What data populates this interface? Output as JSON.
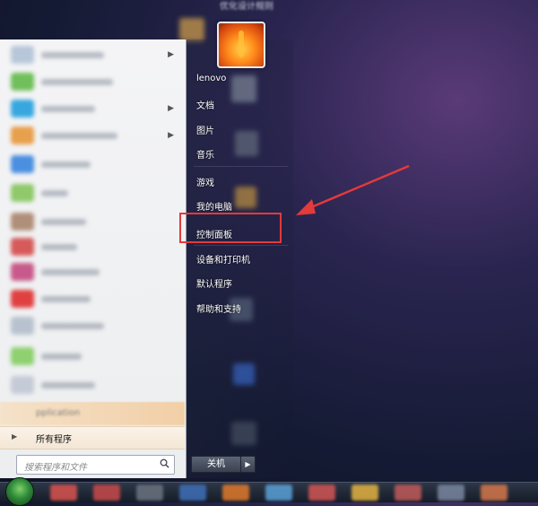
{
  "desktop": {
    "top_title": "优化设计规则"
  },
  "start_menu": {
    "left": {
      "pinned_app_label": "pplication",
      "all_programs": "所有程序",
      "search_placeholder": "搜索程序和文件"
    },
    "right": {
      "items": [
        "lenovo",
        "文档",
        "图片",
        "音乐",
        "游戏",
        "我的电脑",
        "控制面板",
        "设备和打印机",
        "默认程序",
        "帮助和支持"
      ],
      "highlighted_item": "控制面板"
    },
    "shutdown_label": "关机"
  },
  "colors": {
    "highlight_box": "#e33a3a",
    "arrow": "#e33a3a"
  },
  "icons": {
    "search": "search-icon",
    "start": "windows-start-orb-icon",
    "shutdown_more": "triangle-right-icon"
  }
}
